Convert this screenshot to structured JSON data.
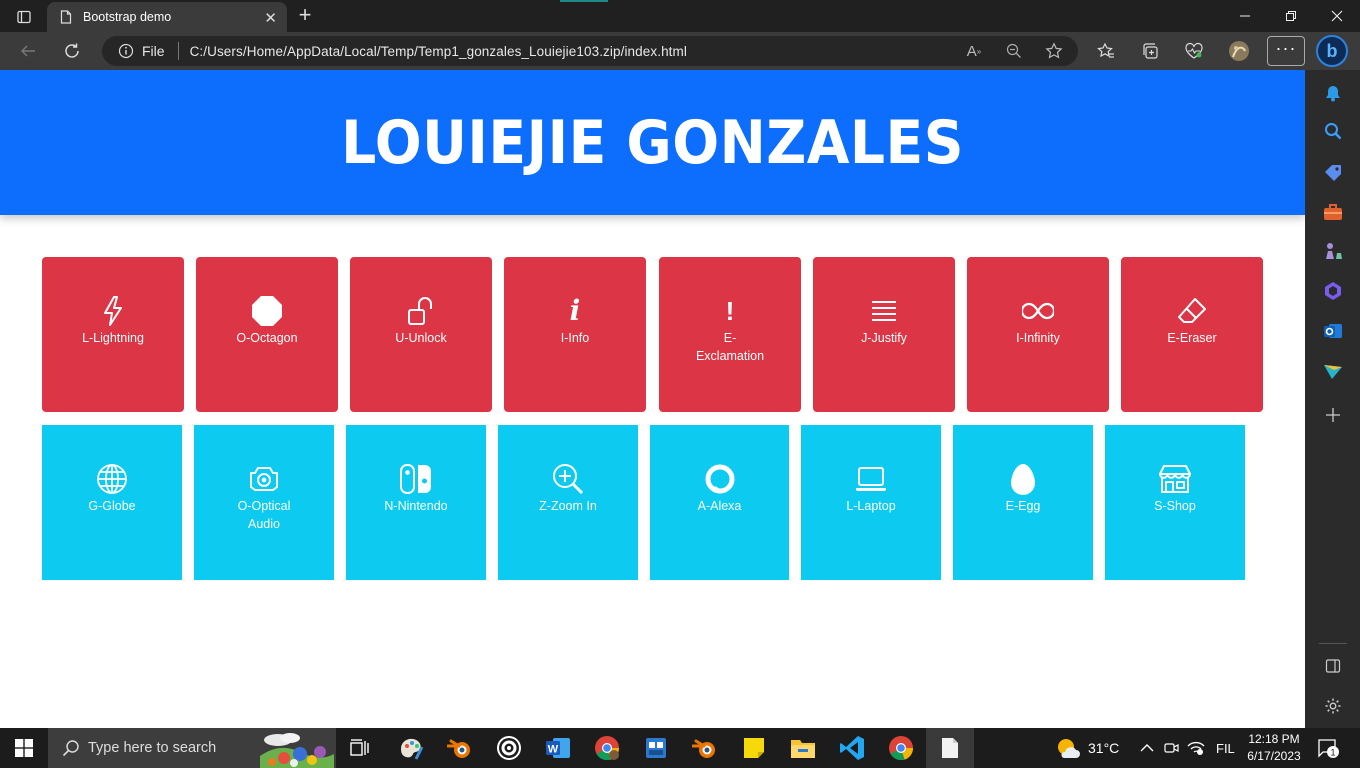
{
  "browser": {
    "tab_title": "Bootstrap demo",
    "address_prefix": "File",
    "url": "C:/Users/Home/AppData/Local/Temp/Temp1_gonzales_Louiejie103.zip/index.html",
    "more_label": "···",
    "profile_badge": "b"
  },
  "page": {
    "heading": "LOUIEJIE GONZALES",
    "row1": [
      {
        "label": "L-Lightning",
        "icon": "lightning-icon"
      },
      {
        "label": "O-Octagon",
        "icon": "octagon-icon"
      },
      {
        "label": "U-Unlock",
        "icon": "unlock-icon"
      },
      {
        "label": "I-Info",
        "icon": "info-icon"
      },
      {
        "label": "E-Exclamation",
        "icon": "exclamation-icon"
      },
      {
        "label": "J-Justify",
        "icon": "justify-icon"
      },
      {
        "label": "I-Infinity",
        "icon": "infinity-icon"
      },
      {
        "label": "E-Eraser",
        "icon": "eraser-icon"
      }
    ],
    "row2": [
      {
        "label": "G-Globe",
        "icon": "globe-icon"
      },
      {
        "label": "O-Optical Audio",
        "icon": "optical-audio-icon"
      },
      {
        "label": "N-Nintendo",
        "icon": "nintendo-switch-icon"
      },
      {
        "label": "Z-Zoom In",
        "icon": "zoom-in-icon"
      },
      {
        "label": "A-Alexa",
        "icon": "alexa-icon"
      },
      {
        "label": "L-Laptop",
        "icon": "laptop-icon"
      },
      {
        "label": "E-Egg",
        "icon": "egg-icon"
      },
      {
        "label": "S-Shop",
        "icon": "shop-icon"
      }
    ],
    "colors": {
      "header": "#0d6efd",
      "row1": "#dc3545",
      "row2": "#0dcaf0"
    }
  },
  "taskbar": {
    "search_placeholder": "Type here to search",
    "temperature": "31°C",
    "language": "FIL",
    "time": "12:18 PM",
    "date": "6/17/2023",
    "notification_count": "1"
  }
}
